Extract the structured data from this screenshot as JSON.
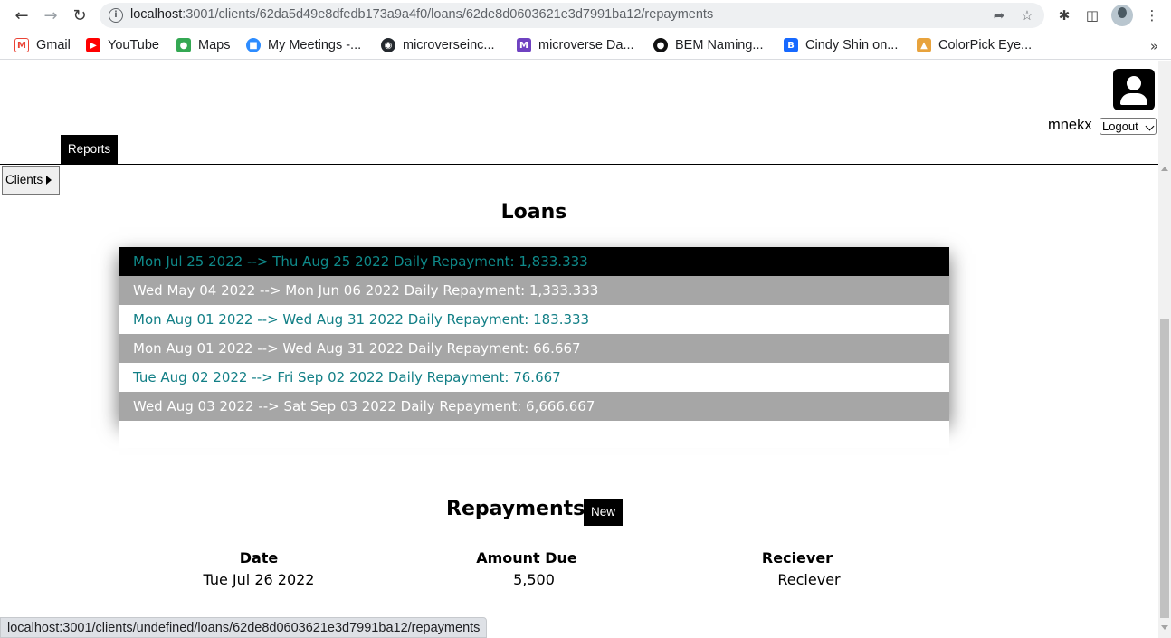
{
  "browser": {
    "url_host": "localhost",
    "url_rest": ":3001/clients/62da5d49e8dfedb173a9a4f0/loans/62de8d0603621e3d7991ba12/repayments",
    "bookmarks": [
      {
        "label": "Gmail",
        "icon": "gmail-icon",
        "color": "#ea4335"
      },
      {
        "label": "YouTube",
        "icon": "youtube-icon",
        "color": "#ff0000"
      },
      {
        "label": "Maps",
        "icon": "maps-icon",
        "color": "#34a853"
      },
      {
        "label": "My Meetings -...",
        "icon": "zoom-icon",
        "color": "#2d8cff"
      },
      {
        "label": "microverseinc...",
        "icon": "github-icon",
        "color": "#24292e"
      },
      {
        "label": "microverse Da...",
        "icon": "microverse-icon",
        "color": "#6f42c1"
      },
      {
        "label": "BEM Naming...",
        "icon": "bem-icon",
        "color": "#111111"
      },
      {
        "label": "Cindy Shin on...",
        "icon": "behance-icon",
        "color": "#1769ff"
      },
      {
        "label": "ColorPick Eye...",
        "icon": "colorpick-icon",
        "color": "#e8a33d"
      }
    ],
    "status_text": "localhost:3001/clients/undefined/loans/62de8d0603621e3d7991ba12/repayments"
  },
  "header": {
    "username": "mnekx",
    "logout_label": "Logout",
    "reports_label": "Reports",
    "clients_label": "Clients"
  },
  "loans": {
    "title": "Loans",
    "items": [
      {
        "text": "Mon Jul 25 2022 --> Thu Aug 25 2022 Daily Repayment: 1,833.333",
        "style": "black"
      },
      {
        "text": "Wed May 04 2022 --> Mon Jun 06 2022 Daily Repayment: 1,333.333",
        "style": "grey"
      },
      {
        "text": "Mon Aug 01 2022 --> Wed Aug 31 2022 Daily Repayment: 183.333",
        "style": "white"
      },
      {
        "text": "Mon Aug 01 2022 --> Wed Aug 31 2022 Daily Repayment: 66.667",
        "style": "grey"
      },
      {
        "text": "Tue Aug 02 2022 --> Fri Sep 02 2022 Daily Repayment: 76.667",
        "style": "white"
      },
      {
        "text": "Wed Aug 03 2022 --> Sat Sep 03 2022 Daily Repayment: 6,666.667",
        "style": "grey"
      }
    ]
  },
  "repayments": {
    "title": "Repayments",
    "new_label": "New",
    "columns": [
      "Date",
      "Amount Due",
      "Reciever"
    ],
    "rows": [
      [
        "Tue Jul 26 2022",
        "5,500",
        "Reciever"
      ]
    ]
  }
}
